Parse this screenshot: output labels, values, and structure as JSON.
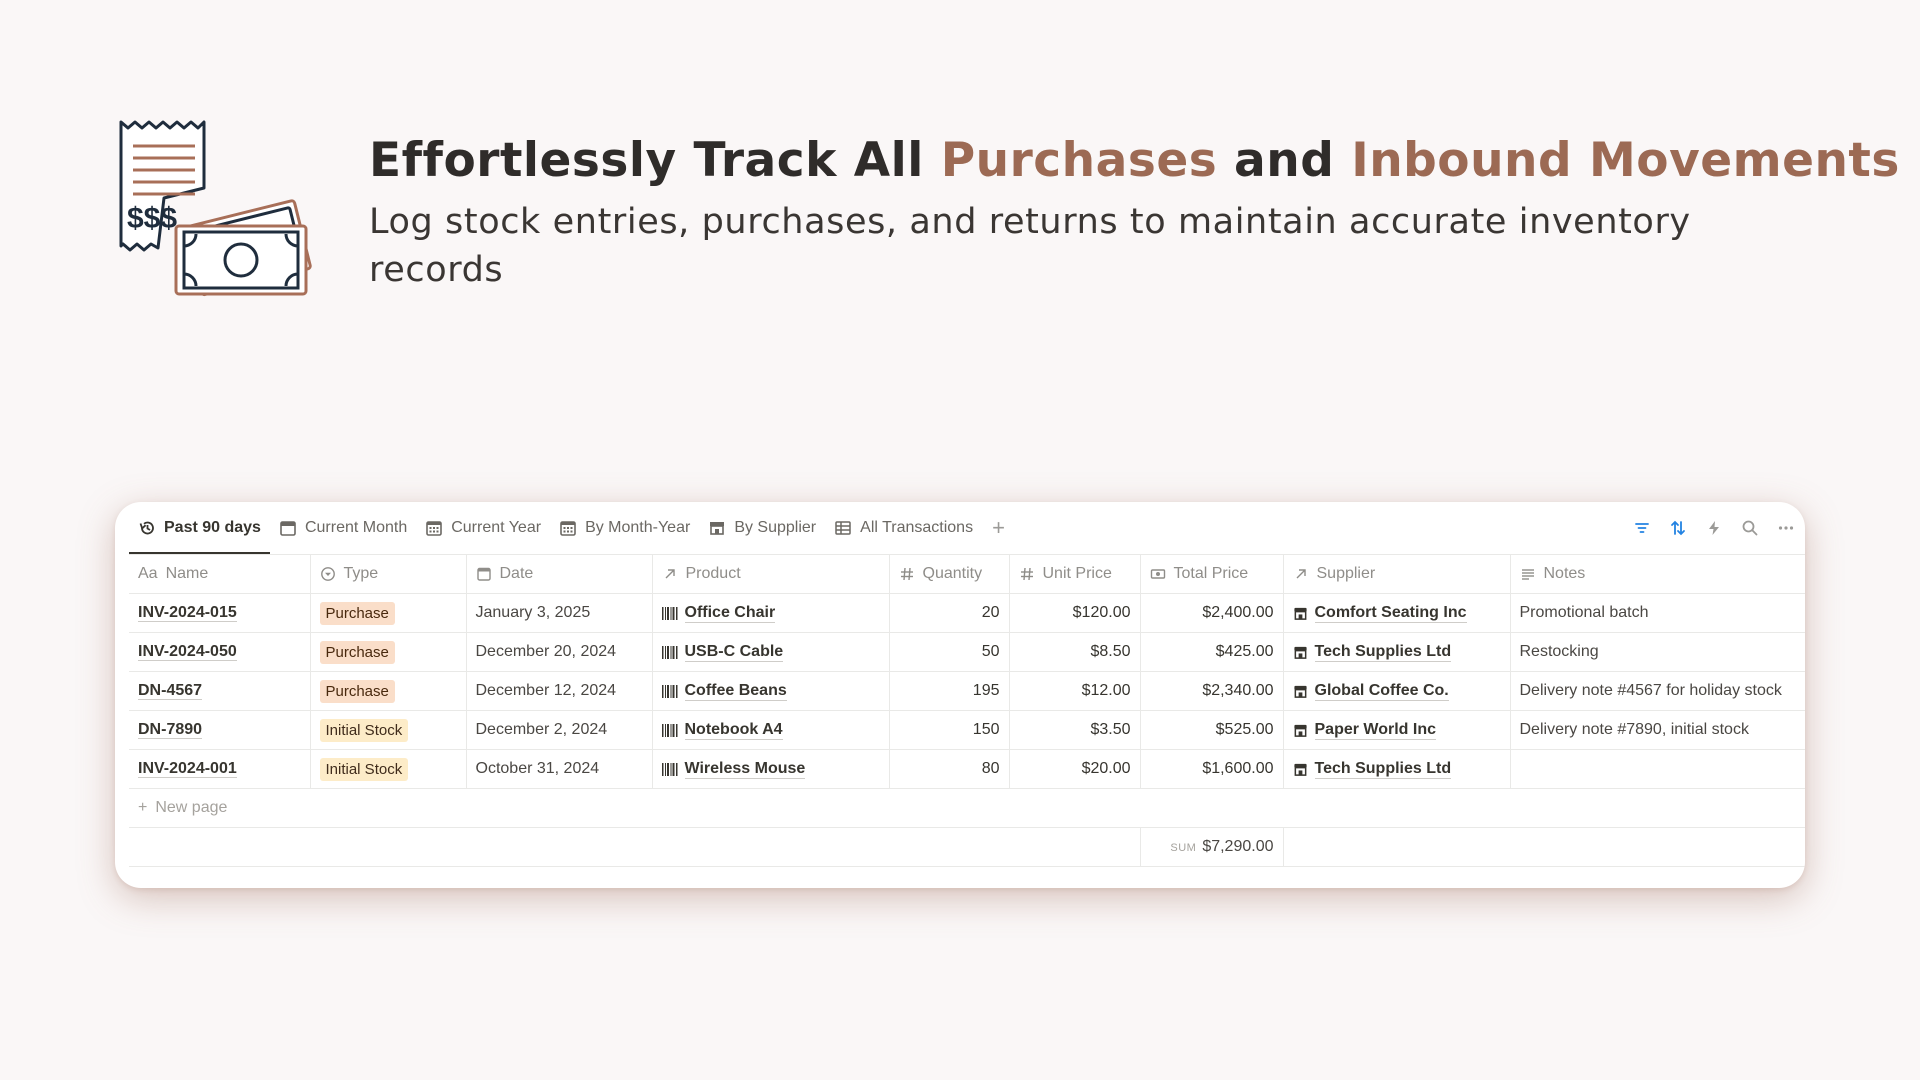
{
  "hero": {
    "title_part1": "Effortlessly Track All ",
    "title_accent1": "Purchases",
    "title_part2": " and ",
    "title_accent2": "Inbound Movements",
    "subtitle": "Log stock entries, purchases, and returns to maintain accurate inventory records",
    "icon": "receipt-money-icon",
    "colors": {
      "accent": "#9c6a54",
      "text": "#2f2c2a",
      "icon_dark": "#1f2d3d"
    }
  },
  "views": {
    "tabs": [
      {
        "label": "Past 90 days",
        "icon": "history-icon",
        "active": true
      },
      {
        "label": "Current Month",
        "icon": "calendar-icon",
        "active": false
      },
      {
        "label": "Current Year",
        "icon": "calendar-grid-icon",
        "active": false
      },
      {
        "label": "By Month-Year",
        "icon": "calendar-grid-icon",
        "active": false
      },
      {
        "label": "By Supplier",
        "icon": "store-icon",
        "active": false
      },
      {
        "label": "All Transactions",
        "icon": "table-icon",
        "active": false
      }
    ],
    "add_icon": "+",
    "tools": [
      "filter-icon",
      "sort-icon",
      "lightning-icon",
      "search-icon",
      "more-icon"
    ]
  },
  "table": {
    "columns": [
      {
        "label": "Name",
        "prefix": "Aa",
        "icon": "title-icon"
      },
      {
        "label": "Type",
        "icon": "select-icon"
      },
      {
        "label": "Date",
        "icon": "calendar-icon"
      },
      {
        "label": "Product",
        "icon": "relation-arrow-icon"
      },
      {
        "label": "Quantity",
        "icon": "number-icon"
      },
      {
        "label": "Unit Price",
        "icon": "number-icon"
      },
      {
        "label": "Total Price",
        "icon": "money-icon"
      },
      {
        "label": "Supplier",
        "icon": "relation-arrow-icon"
      },
      {
        "label": "Notes",
        "icon": "text-lines-icon"
      }
    ],
    "rows": [
      {
        "name": "INV-2024-015",
        "type": "Purchase",
        "date": "January 3, 2025",
        "product": "Office Chair",
        "quantity": "20",
        "unit_price": "$120.00",
        "total_price": "$2,400.00",
        "supplier": "Comfort Seating Inc",
        "notes": "Promotional batch"
      },
      {
        "name": "INV-2024-050",
        "type": "Purchase",
        "date": "December 20, 2024",
        "product": "USB-C Cable",
        "quantity": "50",
        "unit_price": "$8.50",
        "total_price": "$425.00",
        "supplier": "Tech Supplies Ltd",
        "notes": "Restocking"
      },
      {
        "name": "DN-4567",
        "type": "Purchase",
        "date": "December 12, 2024",
        "product": "Coffee Beans",
        "quantity": "195",
        "unit_price": "$12.00",
        "total_price": "$2,340.00",
        "supplier": "Global Coffee Co.",
        "notes": "Delivery note #4567 for holiday stock"
      },
      {
        "name": "DN-7890",
        "type": "Initial Stock",
        "date": "December 2, 2024",
        "product": "Notebook A4",
        "quantity": "150",
        "unit_price": "$3.50",
        "total_price": "$525.00",
        "supplier": "Paper World Inc",
        "notes": "Delivery note #7890, initial stock"
      },
      {
        "name": "INV-2024-001",
        "type": "Initial Stock",
        "date": "October 31, 2024",
        "product": "Wireless Mouse",
        "quantity": "80",
        "unit_price": "$20.00",
        "total_price": "$1,600.00",
        "supplier": "Tech Supplies Ltd",
        "notes": ""
      }
    ],
    "type_colors": {
      "Purchase": {
        "bg": "#fadec9",
        "fg": "#49290e"
      },
      "Initial Stock": {
        "bg": "#fdecc8",
        "fg": "#402c1b"
      }
    },
    "new_page_label": "New page",
    "sum_label": "SUM",
    "sum_value": "$7,290.00"
  }
}
